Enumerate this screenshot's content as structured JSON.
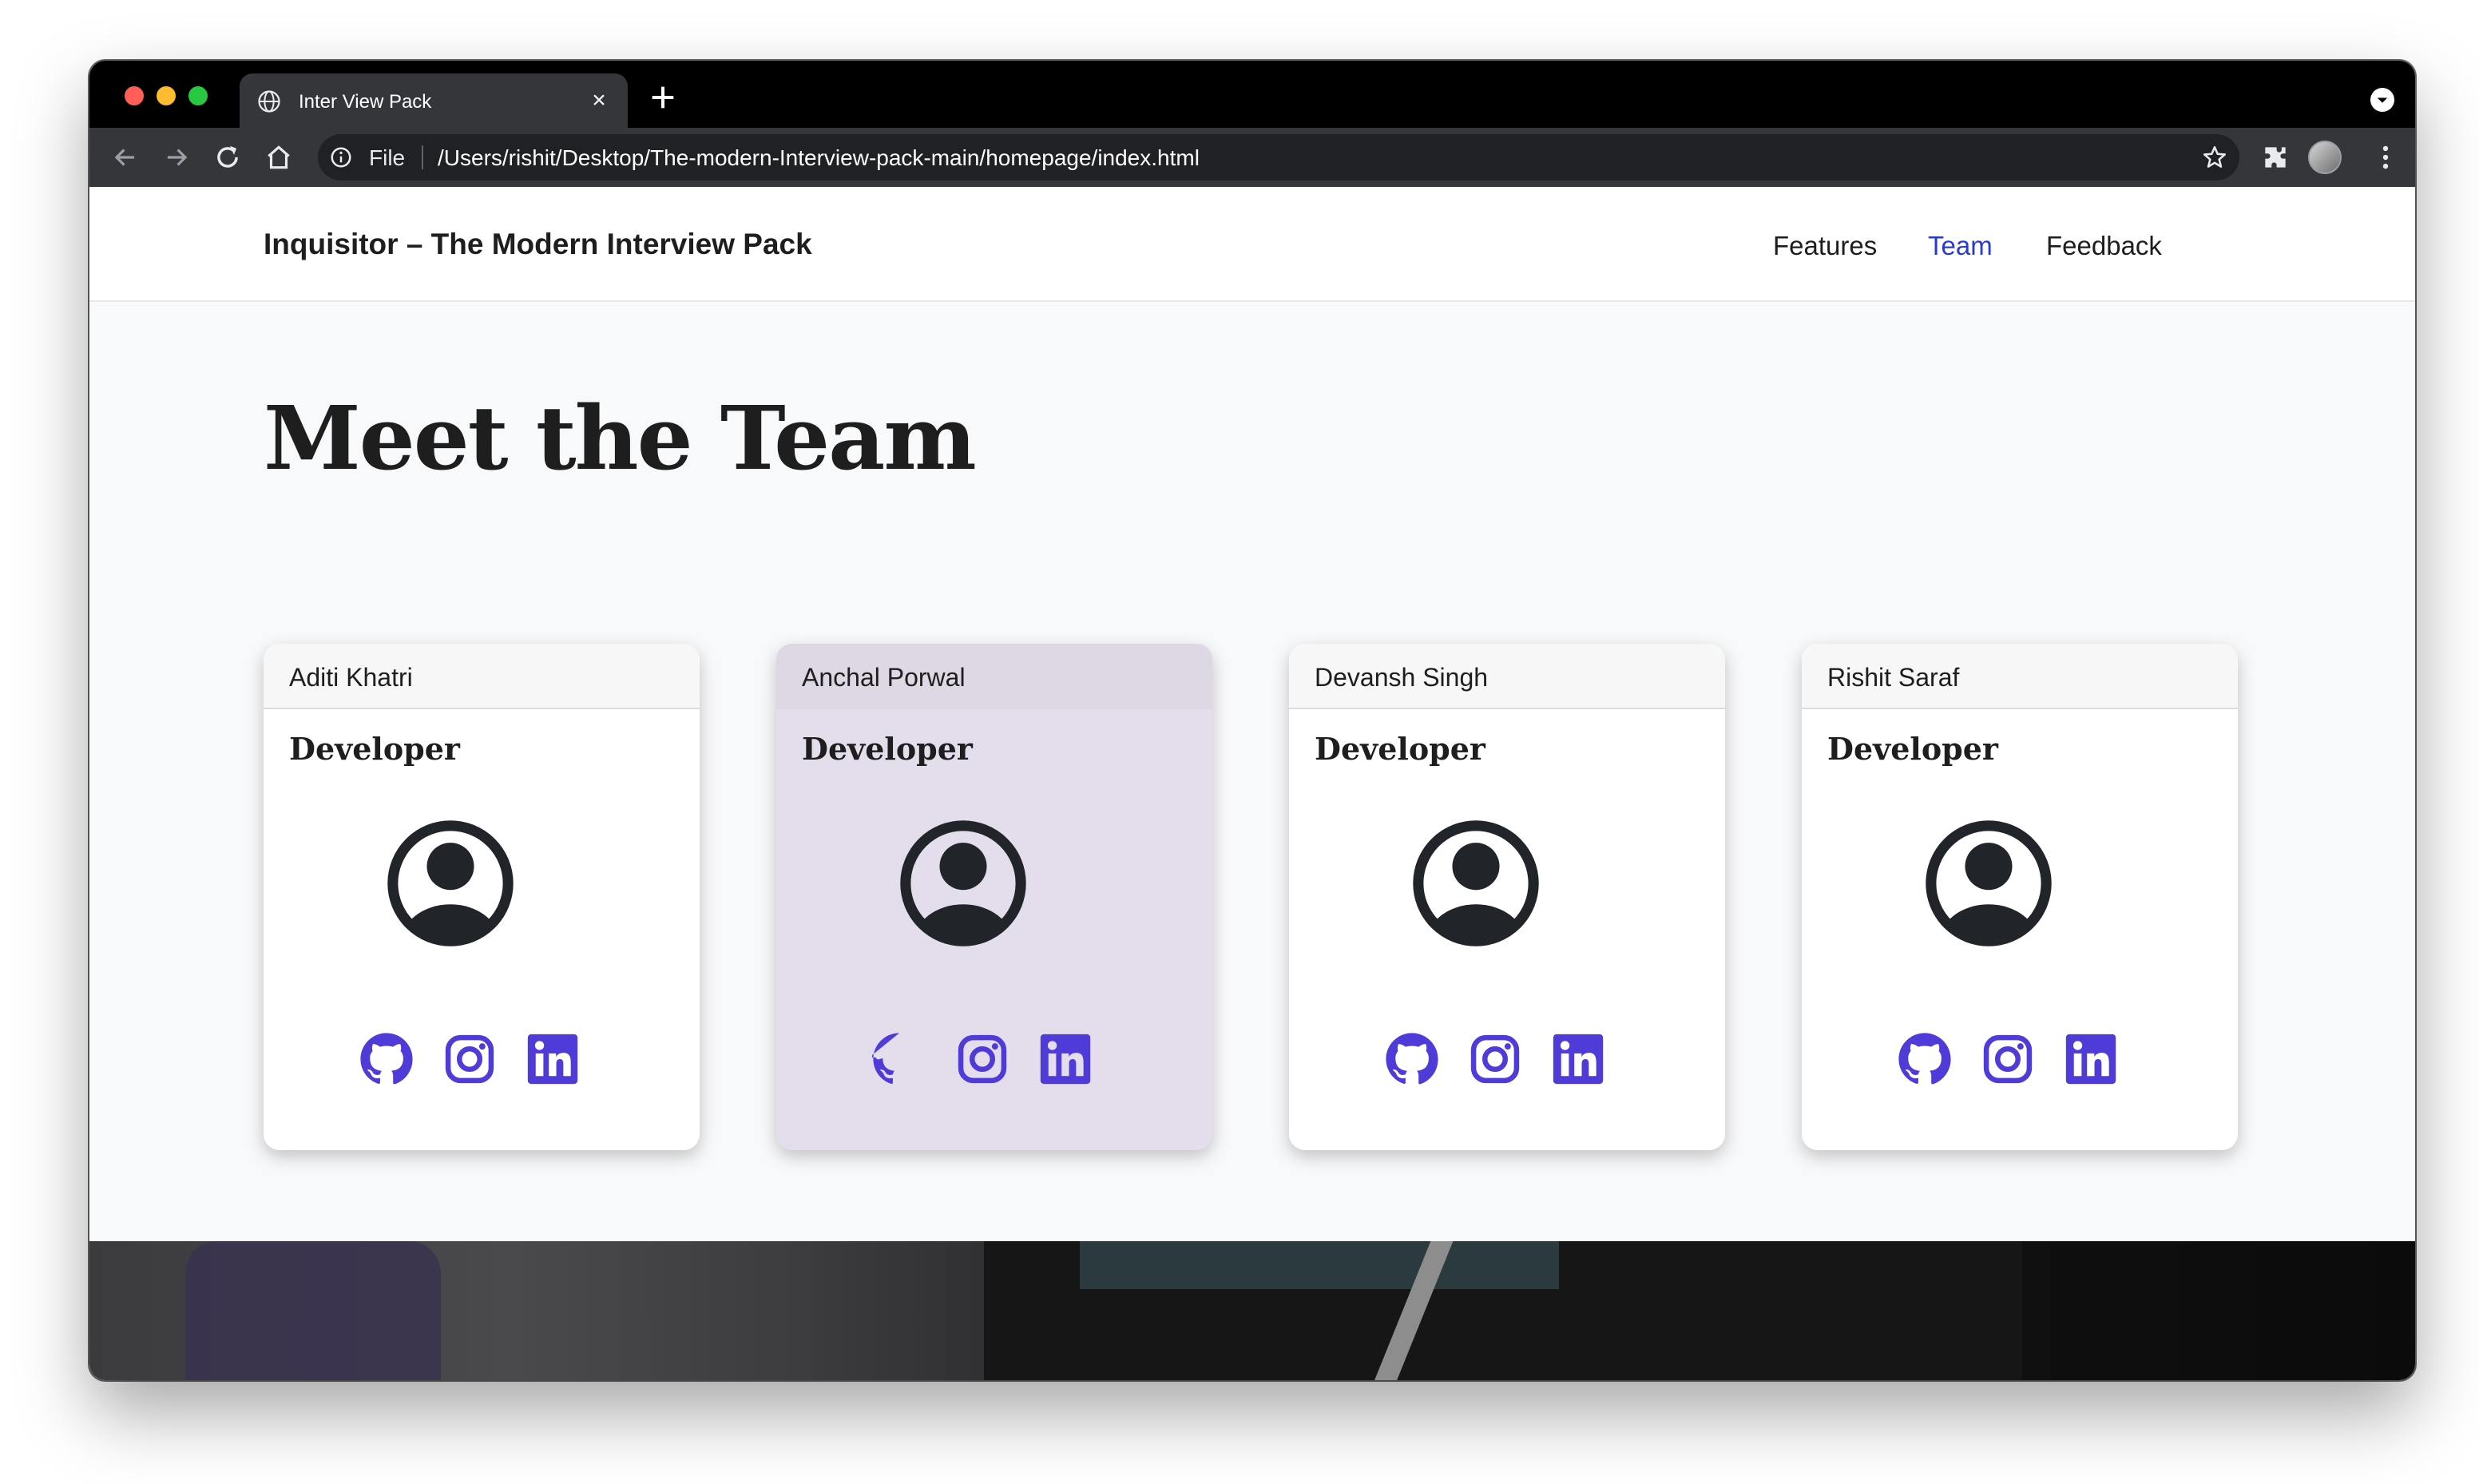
{
  "browser": {
    "tab_title": "Inter View Pack",
    "address_scheme": "File",
    "address_url": "/Users/rishit/Desktop/The-modern-Interview-pack-main/homepage/index.html"
  },
  "navbar": {
    "brand": "Inquisitor – The Modern Interview Pack",
    "links": [
      {
        "label": "Features",
        "active": false
      },
      {
        "label": "Team",
        "active": true
      },
      {
        "label": "Feedback",
        "active": false
      }
    ],
    "active_color": "#2a3bd1"
  },
  "main": {
    "heading": "Meet the Team",
    "cards": [
      {
        "name": "Aditi Khatri",
        "role": "Developer"
      },
      {
        "name": "Anchal Porwal",
        "role": "Developer",
        "highlighted": true
      },
      {
        "name": "Devansh Singh",
        "role": "Developer"
      },
      {
        "name": "Rishit Saraf",
        "role": "Developer"
      }
    ],
    "social_icons": [
      "github-icon",
      "instagram-icon",
      "linkedin-icon"
    ],
    "icon_color": "#4f3bd8"
  }
}
